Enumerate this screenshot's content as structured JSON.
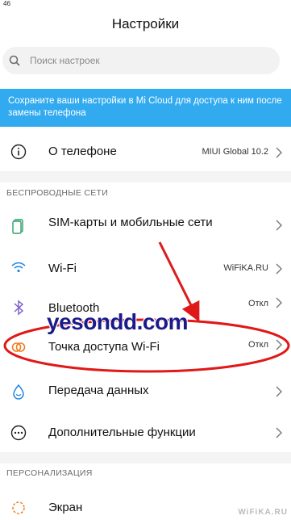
{
  "status": {
    "time": "46"
  },
  "header": {
    "title": "Настройки"
  },
  "search": {
    "placeholder": "Поиск настроек"
  },
  "banner": {
    "text": "Сохраните ваши настройки в Mi Cloud для доступа к ним после замены телефона"
  },
  "about": {
    "label": "О телефоне",
    "value": "MIUI Global 10.2",
    "icon": "info-icon"
  },
  "sections": {
    "wireless": "БЕСПРОВОДНЫЕ СЕТИ",
    "personalization": "ПЕРСОНАЛИЗАЦИЯ"
  },
  "wireless_items": [
    {
      "label": "SIM-карты и мобильные сети",
      "value": "",
      "icon": "sim-card-icon"
    },
    {
      "label": "Wi-Fi",
      "value": "WiFiKA.RU",
      "icon": "wifi-icon"
    },
    {
      "label": "Bluetooth",
      "value": "Откл",
      "icon": "bluetooth-icon"
    },
    {
      "label": "Точка доступа Wi-Fi",
      "value": "Откл",
      "icon": "hotspot-icon"
    },
    {
      "label": "Передача данных",
      "value": "",
      "icon": "data-usage-icon"
    },
    {
      "label": "Дополнительные функции",
      "value": "",
      "icon": "more-icon"
    }
  ],
  "personal_items": [
    {
      "label": "Экран",
      "icon": "display-icon"
    }
  ],
  "overlay": {
    "watermark": "yesondd.com",
    "corner_watermark": "WiFiKA.RU"
  },
  "colors": {
    "banner": "#32aaf0",
    "annotation": "#e01818",
    "watermark": "#1a1a8a"
  }
}
